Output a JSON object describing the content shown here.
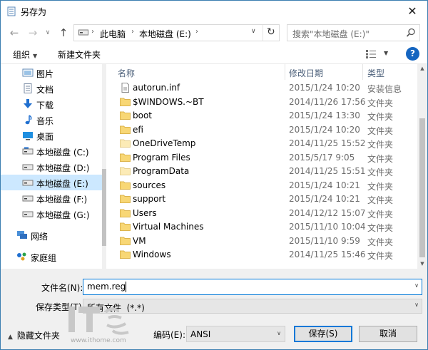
{
  "window": {
    "title": "另存为"
  },
  "nav": {
    "back_glyph": "←",
    "forward_glyph": "→",
    "recent_glyph": "∨",
    "up_glyph": "↑"
  },
  "address": {
    "sep_glyph": "›",
    "parts": [
      "此电脑",
      "本地磁盘 (E:)"
    ],
    "dropdown_glyph": "∨",
    "refresh_glyph": "↻"
  },
  "search": {
    "placeholder": "搜索\"本地磁盘 (E:)\""
  },
  "toolbar": {
    "organize_label": "组织",
    "organize_caret": "▼",
    "new_folder_label": "新建文件夹",
    "view_caret": "▼",
    "help_glyph": "?"
  },
  "sidebar": {
    "items": [
      {
        "label": "图片",
        "icon": "pictures-icon"
      },
      {
        "label": "文档",
        "icon": "documents-icon"
      },
      {
        "label": "下载",
        "icon": "downloads-icon"
      },
      {
        "label": "音乐",
        "icon": "music-icon"
      },
      {
        "label": "桌面",
        "icon": "desktop-icon"
      },
      {
        "label": "本地磁盘 (C:)",
        "icon": "drive-icon"
      },
      {
        "label": "本地磁盘 (D:)",
        "icon": "drive-icon"
      },
      {
        "label": "本地磁盘 (E:)",
        "icon": "drive-icon",
        "selected": true
      },
      {
        "label": "本地磁盘 (F:)",
        "icon": "drive-icon"
      },
      {
        "label": "本地磁盘 (G:)",
        "icon": "drive-icon"
      },
      {
        "label": "网络",
        "icon": "network-icon"
      },
      {
        "label": "家庭组",
        "icon": "homegroup-icon"
      }
    ]
  },
  "filelist": {
    "columns": [
      "名称",
      "修改日期",
      "类型"
    ],
    "sort_glyph": "^",
    "rows": [
      {
        "name": "autorun.inf",
        "date": "2015/1/24 10:20",
        "type": "安装信息",
        "icon": "file-icon"
      },
      {
        "name": "$WINDOWS.~BT",
        "date": "2014/11/26 17:56",
        "type": "文件夹",
        "icon": "folder-icon"
      },
      {
        "name": "boot",
        "date": "2015/1/24 13:30",
        "type": "文件夹",
        "icon": "folder-icon"
      },
      {
        "name": "efi",
        "date": "2015/1/24 10:20",
        "type": "文件夹",
        "icon": "folder-icon"
      },
      {
        "name": "OneDriveTemp",
        "date": "2014/11/25 15:52",
        "type": "文件夹",
        "icon": "folder-icon-light"
      },
      {
        "name": "Program Files",
        "date": "2015/5/17 9:05",
        "type": "文件夹",
        "icon": "folder-icon"
      },
      {
        "name": "ProgramData",
        "date": "2014/11/25 15:51",
        "type": "文件夹",
        "icon": "folder-icon-light"
      },
      {
        "name": "sources",
        "date": "2015/1/24 10:21",
        "type": "文件夹",
        "icon": "folder-icon"
      },
      {
        "name": "support",
        "date": "2015/1/24 10:21",
        "type": "文件夹",
        "icon": "folder-icon"
      },
      {
        "name": "Users",
        "date": "2014/12/12 15:07",
        "type": "文件夹",
        "icon": "folder-icon"
      },
      {
        "name": "Virtual Machines",
        "date": "2015/11/10 10:04",
        "type": "文件夹",
        "icon": "folder-icon"
      },
      {
        "name": "VM",
        "date": "2015/11/10 9:59",
        "type": "文件夹",
        "icon": "folder-icon"
      },
      {
        "name": "Windows",
        "date": "2014/11/25 15:46",
        "type": "文件夹",
        "icon": "folder-icon"
      }
    ]
  },
  "bottom": {
    "filename_label": "文件名(N):",
    "filename_value": "mem.reg",
    "filetype_label": "保存类型(T):",
    "filetype_value": "所有文件  (*.*)",
    "hide_folders_label": "隐藏文件夹",
    "hide_caret": "▲",
    "encoding_label": "编码(E):",
    "encoding_value": "ANSI",
    "save_label": "保存(S)",
    "cancel_label": "取消",
    "dropdown_glyph": "∨"
  },
  "watermark": {
    "text": "IT之家",
    "url": "www.ithome.com"
  },
  "colors": {
    "accent": "#0078d7",
    "selection": "#cce8ff",
    "folder": "#f8d775",
    "help": "#1565c0"
  }
}
